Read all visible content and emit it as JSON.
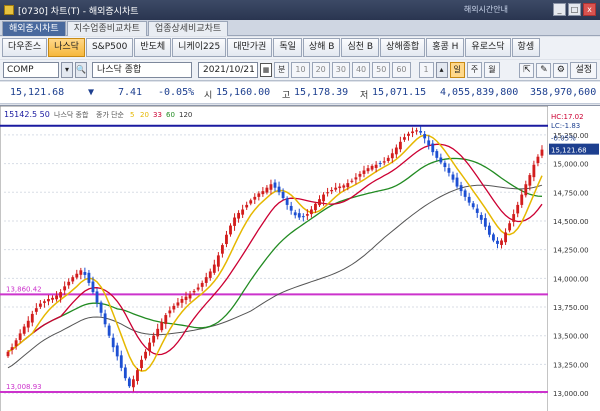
{
  "window": {
    "title": "[0730] 차트(T) - 해외증시차트",
    "notice": "해외시간안내",
    "min": "_",
    "max": "□",
    "close": "x"
  },
  "tabs": [
    {
      "label": "해외증시차트",
      "active": true
    },
    {
      "label": "지수업종비교차트",
      "active": false
    },
    {
      "label": "업종상세비교차트",
      "active": false
    }
  ],
  "market_buttons": [
    {
      "label": "다우존스",
      "active": false
    },
    {
      "label": "나스닥",
      "active": true
    },
    {
      "label": "S&P500",
      "active": false
    },
    {
      "label": "반도체",
      "active": false
    },
    {
      "label": "니케이225",
      "active": false
    },
    {
      "label": "대만가권",
      "active": false
    },
    {
      "label": "독일",
      "active": false
    },
    {
      "label": "상해 B",
      "active": false
    },
    {
      "label": "심천 B",
      "active": false
    },
    {
      "label": "상해종합",
      "active": false
    },
    {
      "label": "홍콩 H",
      "active": false
    },
    {
      "label": "유로스닥",
      "active": false
    },
    {
      "label": "항셍",
      "active": false
    }
  ],
  "controls": {
    "symbol": "COMP",
    "symbol_name": "나스닥 종합",
    "date": "2021/10/21",
    "period_buttons": [
      "분",
      "10",
      "20",
      "30",
      "40",
      "50",
      "60"
    ],
    "count": "1",
    "day": "일",
    "week": "주",
    "month": "월",
    "settings": "설정"
  },
  "quote": {
    "price": "15,121.68",
    "arrow": "▼",
    "change": "7.41",
    "change_pct": "-0.05%",
    "open_label": "시",
    "open": "15,160.00",
    "high_label": "고",
    "high": "15,178.39",
    "low_label": "저",
    "low": "15,071.15",
    "volume": "4,055,839,800",
    "amount": "358,970,600"
  },
  "chart_data": {
    "type": "candlestick",
    "legend": [
      "나스닥 종합",
      "종가 단순",
      "5",
      "20",
      "33",
      "60",
      "120"
    ],
    "legend_prefix": "15142.5 50",
    "y_ticks": [
      "15,250.00",
      "15,000.00",
      "14,750.00",
      "14,500.00",
      "14,250.00",
      "14,000.00",
      "13,750.00",
      "13,500.00",
      "13,250.00",
      "13,000.00"
    ],
    "ylim": [
      12870,
      15380
    ],
    "price_tag": "15,121.68",
    "pct_tag": "-0.05%",
    "hc_label": "HC:17.02",
    "lc_label": "LC:-1.83",
    "hlines": [
      {
        "value": 15330,
        "color": "#1a1aa0",
        "label": ""
      },
      {
        "value": 13860.42,
        "color": "#cc33cc",
        "label": "13,860.42"
      },
      {
        "value": 13008.93,
        "color": "#cc33cc",
        "label": "13,008.93"
      }
    ],
    "closes": [
      13360,
      13400,
      13460,
      13520,
      13580,
      13630,
      13690,
      13740,
      13780,
      13800,
      13820,
      13830,
      13850,
      13880,
      13930,
      13970,
      14010,
      14040,
      14070,
      14030,
      13960,
      13880,
      13790,
      13700,
      13600,
      13500,
      13400,
      13320,
      13220,
      13130,
      13060,
      13120,
      13200,
      13290,
      13360,
      13440,
      13500,
      13560,
      13620,
      13680,
      13720,
      13760,
      13790,
      13820,
      13840,
      13860,
      13890,
      13920,
      13960,
      14010,
      14060,
      14120,
      14200,
      14290,
      14380,
      14460,
      14530,
      14570,
      14600,
      14640,
      14680,
      14710,
      14740,
      14760,
      14790,
      14820,
      14790,
      14750,
      14700,
      14640,
      14590,
      14550,
      14530,
      14540,
      14560,
      14600,
      14650,
      14690,
      14730,
      14750,
      14770,
      14790,
      14800,
      14810,
      14830,
      14850,
      14880,
      14910,
      14940,
      14960,
      14980,
      14990,
      15000,
      15020,
      15050,
      15090,
      15140,
      15190,
      15230,
      15260,
      15280,
      15290,
      15270,
      15220,
      15160,
      15100,
      15050,
      15010,
      14970,
      14920,
      14860,
      14800,
      14760,
      14710,
      14660,
      14620,
      14570,
      14510,
      14450,
      14380,
      14330,
      14300,
      14330,
      14400,
      14480,
      14560,
      14640,
      14730,
      14820,
      14900,
      14990,
      15060,
      15121.68
    ]
  }
}
